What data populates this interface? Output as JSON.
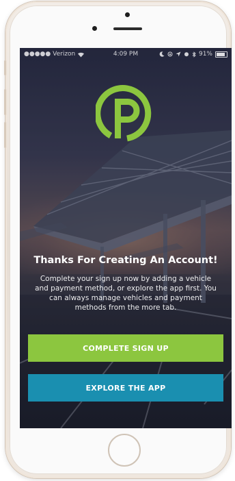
{
  "status_bar": {
    "carrier": "●●●●● Verizon",
    "time": "4:09 PM",
    "battery_percent": "91%",
    "battery_level": 0.91
  },
  "colors": {
    "brand_green": "#8cc63f",
    "brand_blue": "#1a8fb0"
  },
  "logo": {
    "icon": "parking-p-logo-icon"
  },
  "content": {
    "heading": "Thanks For Creating An Account!",
    "body": "Complete your sign up now by adding a vehicle and payment method, or explore the app first. You can always manage vehicles and payment methods from the more tab."
  },
  "buttons": {
    "complete_signup": "COMPLETE SIGN UP",
    "explore_app": "EXPLORE THE APP"
  }
}
